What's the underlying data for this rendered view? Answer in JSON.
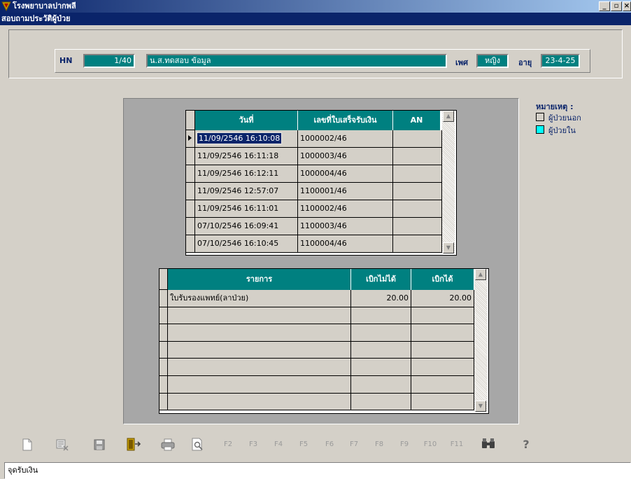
{
  "window": {
    "title": "โรงพยาบาลปากพลี",
    "form_title": "สอบถามประวัติผู้ป่วย"
  },
  "header": {
    "hn_label": "HN",
    "hn_value": "1/40",
    "name_value": "น.ส.ทดสอบ ข้อมูล",
    "sex_label": "เพศ",
    "sex_value": "หญิง",
    "age_label": "อายุ",
    "age_value": "23-4-25"
  },
  "legend": {
    "title": "หมายเหตุ :",
    "outpatient": "ผู้ป่วยนอก",
    "inpatient": "ผู้ป่วยใน",
    "inpatient_color": "#00ffff"
  },
  "receipts": {
    "columns": [
      "วันที่",
      "เลขที่ใบเสร็จรับเงิน",
      "AN"
    ],
    "rows": [
      {
        "date": "11/09/2546 16:10:08",
        "receipt": "1000002/46",
        "an": ""
      },
      {
        "date": "11/09/2546 16:11:18",
        "receipt": "1000003/46",
        "an": ""
      },
      {
        "date": "11/09/2546 16:12:11",
        "receipt": "1000004/46",
        "an": ""
      },
      {
        "date": "11/09/2546 12:57:07",
        "receipt": "1100001/46",
        "an": ""
      },
      {
        "date": "11/09/2546 16:11:01",
        "receipt": "1100002/46",
        "an": ""
      },
      {
        "date": "07/10/2546 16:09:41",
        "receipt": "1100003/46",
        "an": ""
      },
      {
        "date": "07/10/2546 16:10:45",
        "receipt": "1100004/46",
        "an": ""
      }
    ]
  },
  "items": {
    "columns": [
      "รายการ",
      "เบิกไม่ได้",
      "เบิกได้"
    ],
    "rows": [
      {
        "name": "ใบรับรองแพทย์(ลาป่วย)",
        "not_claimable": "20.00",
        "claimable": "20.00"
      },
      {
        "name": "",
        "not_claimable": "",
        "claimable": ""
      },
      {
        "name": "",
        "not_claimable": "",
        "claimable": ""
      },
      {
        "name": "",
        "not_claimable": "",
        "claimable": ""
      },
      {
        "name": "",
        "not_claimable": "",
        "claimable": ""
      },
      {
        "name": "",
        "not_claimable": "",
        "claimable": ""
      },
      {
        "name": "",
        "not_claimable": "",
        "claimable": ""
      }
    ]
  },
  "toolbar": {
    "icons": [
      "new-document-icon",
      "delete-record-icon",
      "save-icon",
      "exit-icon",
      "print-icon",
      "print-preview-icon",
      "search-binoculars-icon",
      "help-icon"
    ],
    "fkeys": [
      "F2",
      "F3",
      "F4",
      "F5",
      "F6",
      "F7",
      "F8",
      "F9",
      "F10",
      "F11"
    ]
  },
  "status": {
    "text": "จุดรับเงิน"
  }
}
